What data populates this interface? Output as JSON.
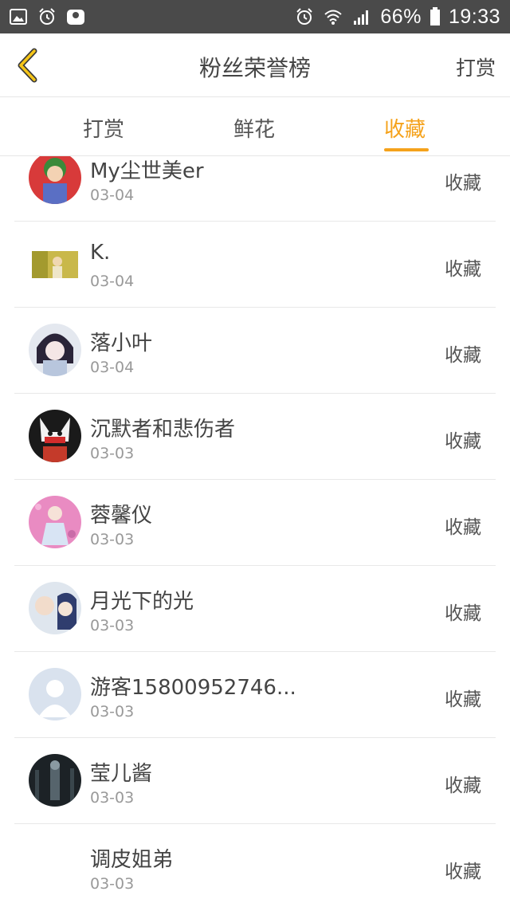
{
  "status_bar": {
    "battery": "66%",
    "time": "19:33"
  },
  "header": {
    "title": "粉丝荣誉榜",
    "right_action": "打赏"
  },
  "tabs": [
    {
      "label": "打赏",
      "active": false
    },
    {
      "label": "鲜花",
      "active": false
    },
    {
      "label": "收藏",
      "active": true
    }
  ],
  "accent_color": "#f5a21b",
  "fans": [
    {
      "name": "My尘世美er",
      "date": "03-04",
      "action": "收藏"
    },
    {
      "name": "K.",
      "date": "03-04",
      "action": "收藏"
    },
    {
      "name": "落小叶",
      "date": "03-04",
      "action": "收藏"
    },
    {
      "name": "沉默者和悲伤者",
      "date": "03-03",
      "action": "收藏"
    },
    {
      "name": "蓉馨仪",
      "date": "03-03",
      "action": "收藏"
    },
    {
      "name": "月光下的光",
      "date": "03-03",
      "action": "收藏"
    },
    {
      "name": "游客15800952746...",
      "date": "03-03",
      "action": "收藏"
    },
    {
      "name": "莹儿酱",
      "date": "03-03",
      "action": "收藏"
    },
    {
      "name": "调皮姐弟",
      "date": "03-03",
      "action": "收藏"
    }
  ]
}
